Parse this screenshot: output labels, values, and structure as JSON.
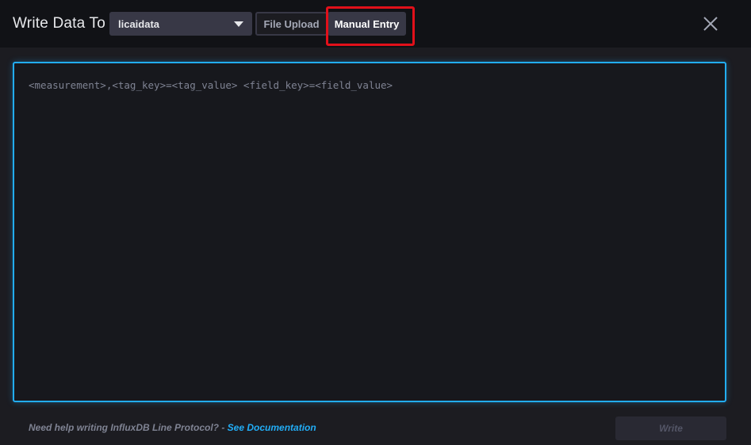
{
  "header": {
    "title": "Write Data To",
    "bucket_select": {
      "selected": "licaidata"
    },
    "tabs": [
      {
        "label": "File Upload",
        "active": false
      },
      {
        "label": "Manual Entry",
        "active": true
      }
    ]
  },
  "editor": {
    "value": "",
    "placeholder": "<measurement>,<tag_key>=<tag_value> <field_key>=<field_value>"
  },
  "footer": {
    "help_text": "Need help writing InfluxDB Line Protocol? - ",
    "help_link": "See Documentation",
    "write_label": "Write",
    "write_disabled": true
  },
  "colors": {
    "background": "#1c1c21",
    "header": "#111216",
    "accent": "#22adf6",
    "highlight": "#e2101a"
  }
}
